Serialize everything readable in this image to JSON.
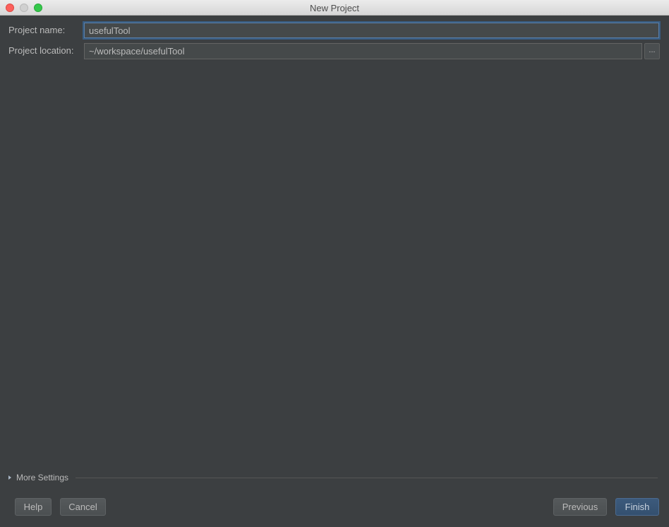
{
  "window": {
    "title": "New Project"
  },
  "form": {
    "project_name_label": "Project name:",
    "project_name_value": "usefulTool",
    "project_location_label": "Project location:",
    "project_location_value": "~/workspace/usefulTool",
    "browse_label": "..."
  },
  "more_settings": {
    "label": "More Settings",
    "expanded": false
  },
  "buttons": {
    "help": "Help",
    "cancel": "Cancel",
    "previous": "Previous",
    "finish": "Finish"
  },
  "colors": {
    "background": "#3c3f41",
    "text": "#bbbbbb",
    "focus_border": "#5b7fa8",
    "default_button": "#3c5a7c"
  },
  "icons": {
    "close": "traffic-light-close",
    "minimize": "traffic-light-minimize",
    "maximize": "traffic-light-maximize",
    "expand": "triangle-right"
  }
}
